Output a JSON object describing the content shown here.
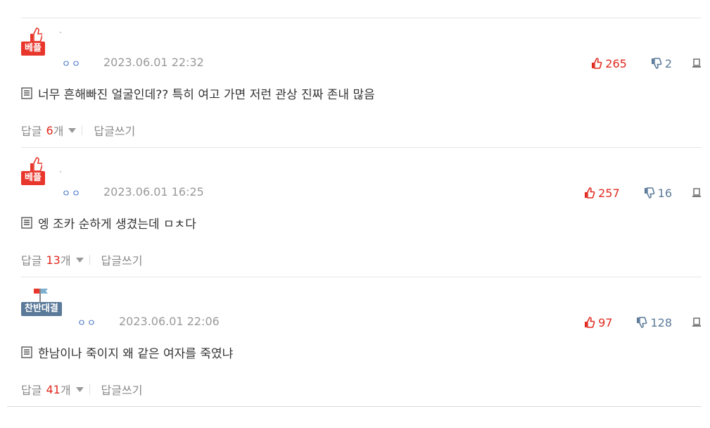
{
  "comments": [
    {
      "badge": "베플",
      "badge_type": "best",
      "user": "ㅇㅇ",
      "date": "2023.06.01 22:32",
      "up": "265",
      "down": "2",
      "text": "너무 흔해빠진 얼굴인데?? 특히 여고 가면 저런 관상 진짜 존내 많음",
      "reply_prefix": "답글",
      "reply_count": "6",
      "reply_suffix": "개",
      "write_reply": "답글쓰기"
    },
    {
      "badge": "베플",
      "badge_type": "best",
      "user": "ㅇㅇ",
      "date": "2023.06.01 16:25",
      "up": "257",
      "down": "16",
      "text": "엥 조카 순하게 생겼는데 ㅁㅊ다",
      "reply_prefix": "답글",
      "reply_count": "13",
      "reply_suffix": "개",
      "write_reply": "답글쓰기"
    },
    {
      "badge": "찬반대결",
      "badge_type": "debate",
      "user": "ㅇㅇ",
      "date": "2023.06.01 22:06",
      "up": "97",
      "down": "128",
      "text": "한남이나 죽이지 왜 같은 여자를 죽였냐",
      "reply_prefix": "답글",
      "reply_count": "41",
      "reply_suffix": "개",
      "write_reply": "답글쓰기"
    }
  ],
  "colors": {
    "up": "#e02a1f",
    "down": "#5b7a99",
    "best_badge": "#e8362c",
    "debate_badge": "#5b7a99"
  },
  "icons": [
    "thumbs-up-icon",
    "flag-icon",
    "upvote-icon",
    "downvote-icon",
    "report-icon",
    "document-icon",
    "caret-down-icon"
  ]
}
